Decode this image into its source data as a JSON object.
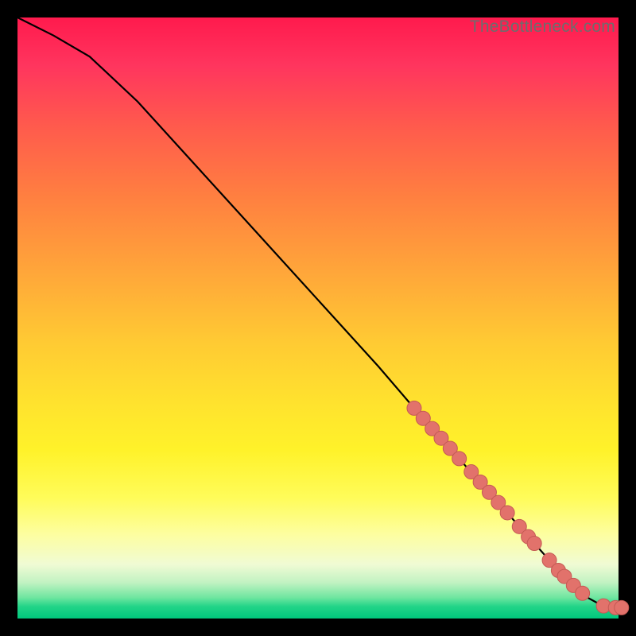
{
  "watermark": "TheBottleneck.com",
  "colors": {
    "marker_fill": "#e2726b",
    "marker_stroke": "#c45a54",
    "line": "#000000"
  },
  "chart_data": {
    "type": "line",
    "title": "",
    "xlabel": "",
    "ylabel": "",
    "xlim": [
      0,
      100
    ],
    "ylim": [
      0,
      100
    ],
    "curve": {
      "x": [
        0,
        6,
        12,
        20,
        30,
        40,
        50,
        60,
        66,
        70,
        74,
        78,
        82,
        86,
        90,
        93,
        95,
        97,
        99,
        100
      ],
      "y": [
        100,
        97,
        93.5,
        86,
        75,
        64,
        53,
        42,
        35,
        30.5,
        26,
        21.5,
        17,
        12.5,
        8,
        5,
        3.4,
        2.3,
        1.8,
        1.8
      ]
    },
    "series": [
      {
        "name": "markers",
        "points": [
          {
            "x": 66,
            "y": 35
          },
          {
            "x": 67.5,
            "y": 33.3
          },
          {
            "x": 69,
            "y": 31.6
          },
          {
            "x": 70.5,
            "y": 30
          },
          {
            "x": 72,
            "y": 28.3
          },
          {
            "x": 73.5,
            "y": 26.6
          },
          {
            "x": 75.5,
            "y": 24.4
          },
          {
            "x": 77,
            "y": 22.7
          },
          {
            "x": 78.5,
            "y": 21
          },
          {
            "x": 80,
            "y": 19.3
          },
          {
            "x": 81.5,
            "y": 17.6
          },
          {
            "x": 83.5,
            "y": 15.3
          },
          {
            "x": 85,
            "y": 13.6
          },
          {
            "x": 86,
            "y": 12.5
          },
          {
            "x": 88.5,
            "y": 9.7
          },
          {
            "x": 90,
            "y": 8
          },
          {
            "x": 91,
            "y": 7
          },
          {
            "x": 92.5,
            "y": 5.5
          },
          {
            "x": 94,
            "y": 4.2
          },
          {
            "x": 97.5,
            "y": 2.1
          },
          {
            "x": 99.5,
            "y": 1.8
          },
          {
            "x": 100.5,
            "y": 1.8
          }
        ]
      }
    ]
  }
}
